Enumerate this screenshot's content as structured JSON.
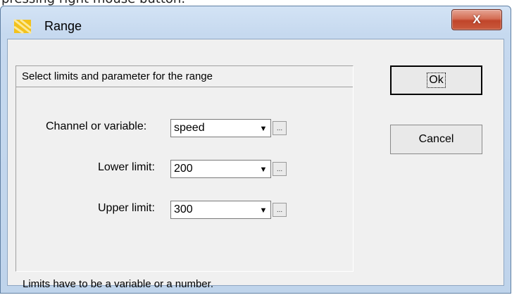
{
  "document": {
    "partial_text": "pressing right mouse button."
  },
  "window": {
    "title": "Range",
    "close_label": "X"
  },
  "group": {
    "header": "Select limits and parameter for the range",
    "hint": "Limits have to be a variable or a number."
  },
  "fields": [
    {
      "label": "Channel or variable:",
      "value": "speed",
      "dots": "..."
    },
    {
      "label": "Lower limit:",
      "value": "200",
      "dots": "..."
    },
    {
      "label": "Upper limit:",
      "value": "300",
      "dots": "..."
    }
  ],
  "buttons": {
    "ok_label": "Ok",
    "cancel_label": "Cancel"
  }
}
